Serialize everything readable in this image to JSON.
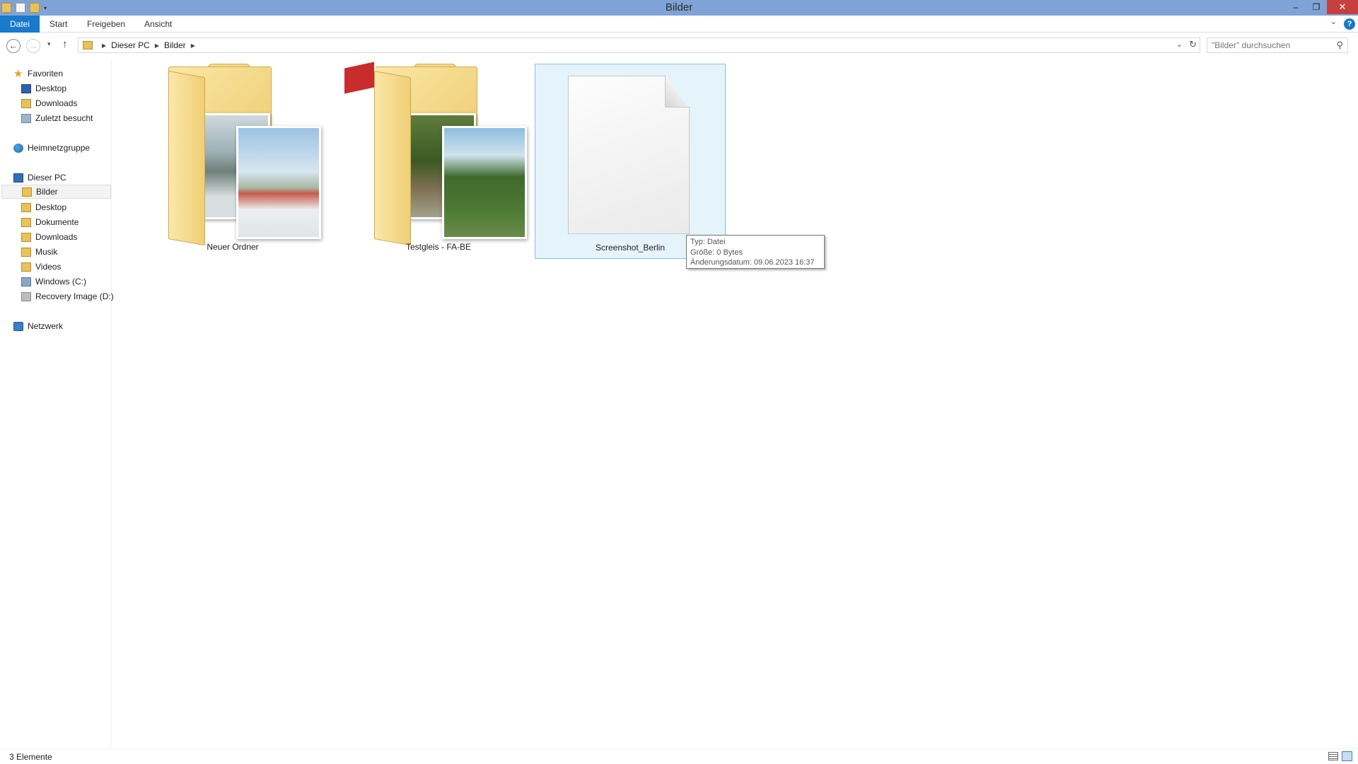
{
  "window": {
    "title": "Bilder"
  },
  "title_controls": {
    "minimize": "–",
    "maximize": "❐",
    "close": "✕"
  },
  "ribbon": {
    "tabs": [
      "Datei",
      "Start",
      "Freigeben",
      "Ansicht"
    ],
    "expand_glyph": "⌄",
    "help_glyph": "?"
  },
  "navigation": {
    "back": "←",
    "forward": "→",
    "recent": "▾",
    "up": "↑",
    "breadcrumb": [
      "Dieser PC",
      "Bilder"
    ],
    "search_placeholder": "\"Bilder\" durchsuchen"
  },
  "sidebar": {
    "favorites": {
      "label": "Favoriten",
      "items": [
        "Desktop",
        "Downloads",
        "Zuletzt besucht"
      ]
    },
    "homegroup": {
      "label": "Heimnetzgruppe"
    },
    "this_pc": {
      "label": "Dieser PC",
      "items": [
        "Bilder",
        "Desktop",
        "Dokumente",
        "Downloads",
        "Musik",
        "Videos",
        "Windows (C:)",
        "Recovery Image (D:)"
      ]
    },
    "network": {
      "label": "Netzwerk"
    },
    "selected": "Bilder"
  },
  "files": [
    {
      "name": "Neuer Ordner",
      "type": "folder"
    },
    {
      "name": "Testgleis - FA-BE",
      "type": "folder"
    },
    {
      "name": "Screenshot_Berlin",
      "type": "file",
      "selected": true
    }
  ],
  "tooltip": {
    "type": "Typ: Datei",
    "size": "Größe: 0 Bytes",
    "modified": "Änderungsdatum: 09.06.2023 16:37"
  },
  "status": {
    "count": "3 Elemente"
  },
  "icons": {
    "back": "back-arrow-icon",
    "forward": "forward-arrow-icon",
    "up": "up-arrow-icon",
    "search": "search-icon",
    "refresh": "refresh-icon",
    "help": "help-icon"
  },
  "colors": {
    "titlebar": "#7fa3d6",
    "accent": "#1979ca",
    "selection": "#e5f3fb",
    "close": "#c74040"
  }
}
